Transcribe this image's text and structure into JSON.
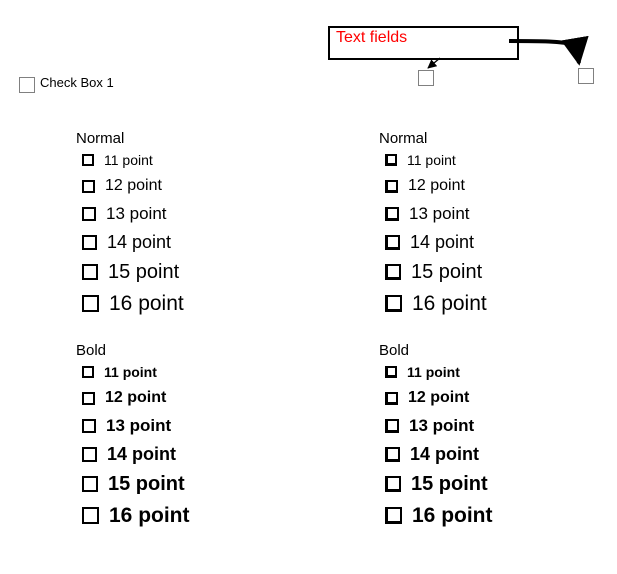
{
  "callout": {
    "label": "Text fields"
  },
  "topCheckbox": {
    "label": "Check Box 1"
  },
  "groups": {
    "leftNormal": {
      "title": "Normal"
    },
    "rightNormal": {
      "title": "Normal"
    },
    "leftBold": {
      "title": "Bold"
    },
    "rightBold": {
      "title": "Bold"
    }
  },
  "items": {
    "p11": "11 point",
    "p12": "12 point",
    "p13": "13 point",
    "p14": "14 point",
    "p15": "15 point",
    "p16": "16 point"
  }
}
